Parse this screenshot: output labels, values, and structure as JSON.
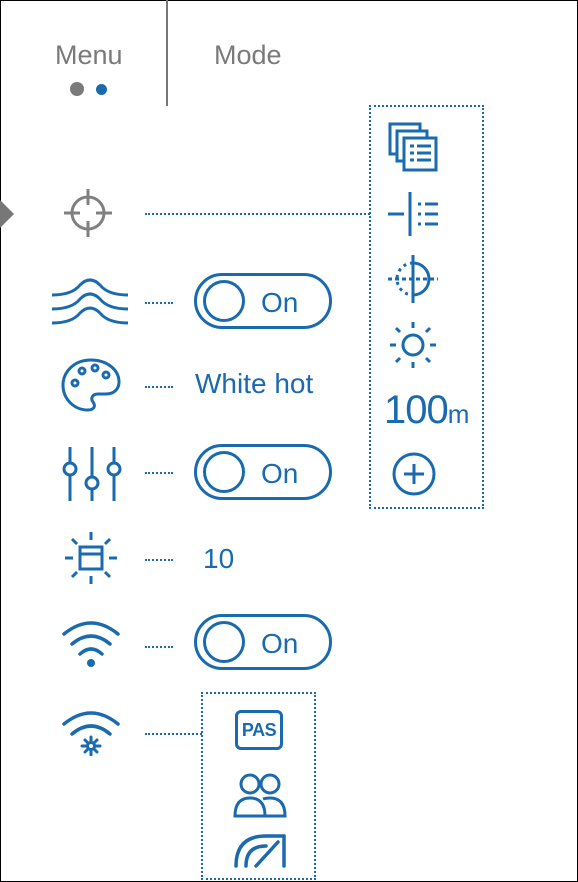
{
  "tabs": {
    "menu_label": "Menu",
    "mode_label": "Mode"
  },
  "colors": {
    "accent": "#1a6aaf",
    "gray": "#7a7a7a"
  },
  "rows": {
    "smooth": {
      "toggle_label": "On"
    },
    "palette": {
      "value": "White hot"
    },
    "calibration": {
      "toggle_label": "On"
    },
    "pip": {
      "value": "10"
    },
    "wifi": {
      "toggle_label": "On"
    }
  },
  "right_panel": {
    "range_value": "100",
    "range_unit": "m"
  },
  "wifi_settings": {
    "pas_label": "PAS"
  }
}
